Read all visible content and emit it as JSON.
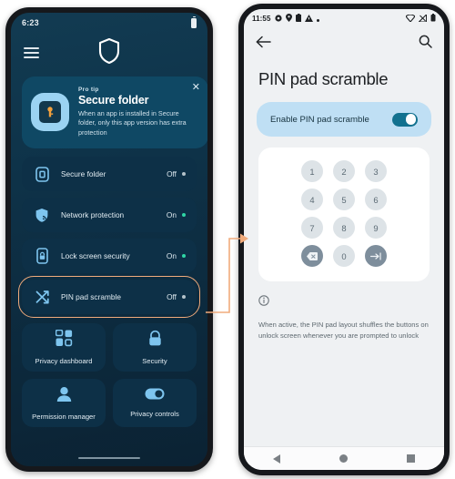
{
  "left_phone": {
    "status_bar": {
      "time": "6:23",
      "battery_icon": "battery-icon"
    },
    "app_bar": {
      "menu_icon": "hamburger-menu-icon",
      "logo_icon": "shield-logo-icon"
    },
    "pro_tip_card": {
      "kicker": "Pro tip",
      "title": "Secure folder",
      "description": "When an app is installed in Secure folder, only this app version has extra protection",
      "close_label": "✕",
      "icon": "secure-folder-key-icon"
    },
    "list_items": [
      {
        "label": "Secure folder",
        "state": "Off",
        "state_on": false,
        "icon": "secure-folder-icon"
      },
      {
        "label": "Network protection",
        "state": "On",
        "state_on": true,
        "icon": "network-shield-icon"
      },
      {
        "label": "Lock screen security",
        "state": "On",
        "state_on": true,
        "icon": "phone-lock-icon"
      },
      {
        "label": "PIN pad scramble",
        "state": "Off",
        "state_on": false,
        "icon": "shuffle-icon",
        "highlighted": true
      }
    ],
    "tiles": [
      {
        "label": "Privacy dashboard",
        "icon": "dashboard-grid-icon"
      },
      {
        "label": "Security",
        "icon": "lock-icon"
      },
      {
        "label": "Permission manager",
        "icon": "person-icon"
      },
      {
        "label": "Privacy controls",
        "icon": "toggle-icon"
      }
    ],
    "home_indicator": "home-gesture-bar"
  },
  "right_phone": {
    "status_bar": {
      "time": "11:55",
      "left_icons": [
        "gear-icon",
        "location-pin-icon",
        "clipboard-icon",
        "warning-triangle-icon",
        "dot-icon"
      ],
      "right_icons": [
        "wifi-icon",
        "signal-icon",
        "battery-icon"
      ]
    },
    "app_bar": {
      "back_icon": "back-arrow-icon",
      "search_icon": "search-icon"
    },
    "title": "PIN pad scramble",
    "toggle_row": {
      "label": "Enable PIN pad scramble",
      "enabled": true,
      "accent": "#12718f"
    },
    "keypad": {
      "keys": [
        "1",
        "2",
        "3",
        "4",
        "5",
        "6",
        "7",
        "8",
        "9"
      ],
      "backspace_icon": "backspace-icon",
      "zero": "0",
      "enter_icon": "enter-arrow-icon"
    },
    "note": {
      "icon": "info-icon",
      "text": "When active, the PIN pad layout shuffles the buttons on unlock screen whenever you are prompted to unlock"
    },
    "nav_bar": {
      "back": "nav-back-icon",
      "home": "nav-home-icon",
      "recents": "nav-recents-icon"
    }
  },
  "connector": {
    "color": "#f0ab7c"
  }
}
